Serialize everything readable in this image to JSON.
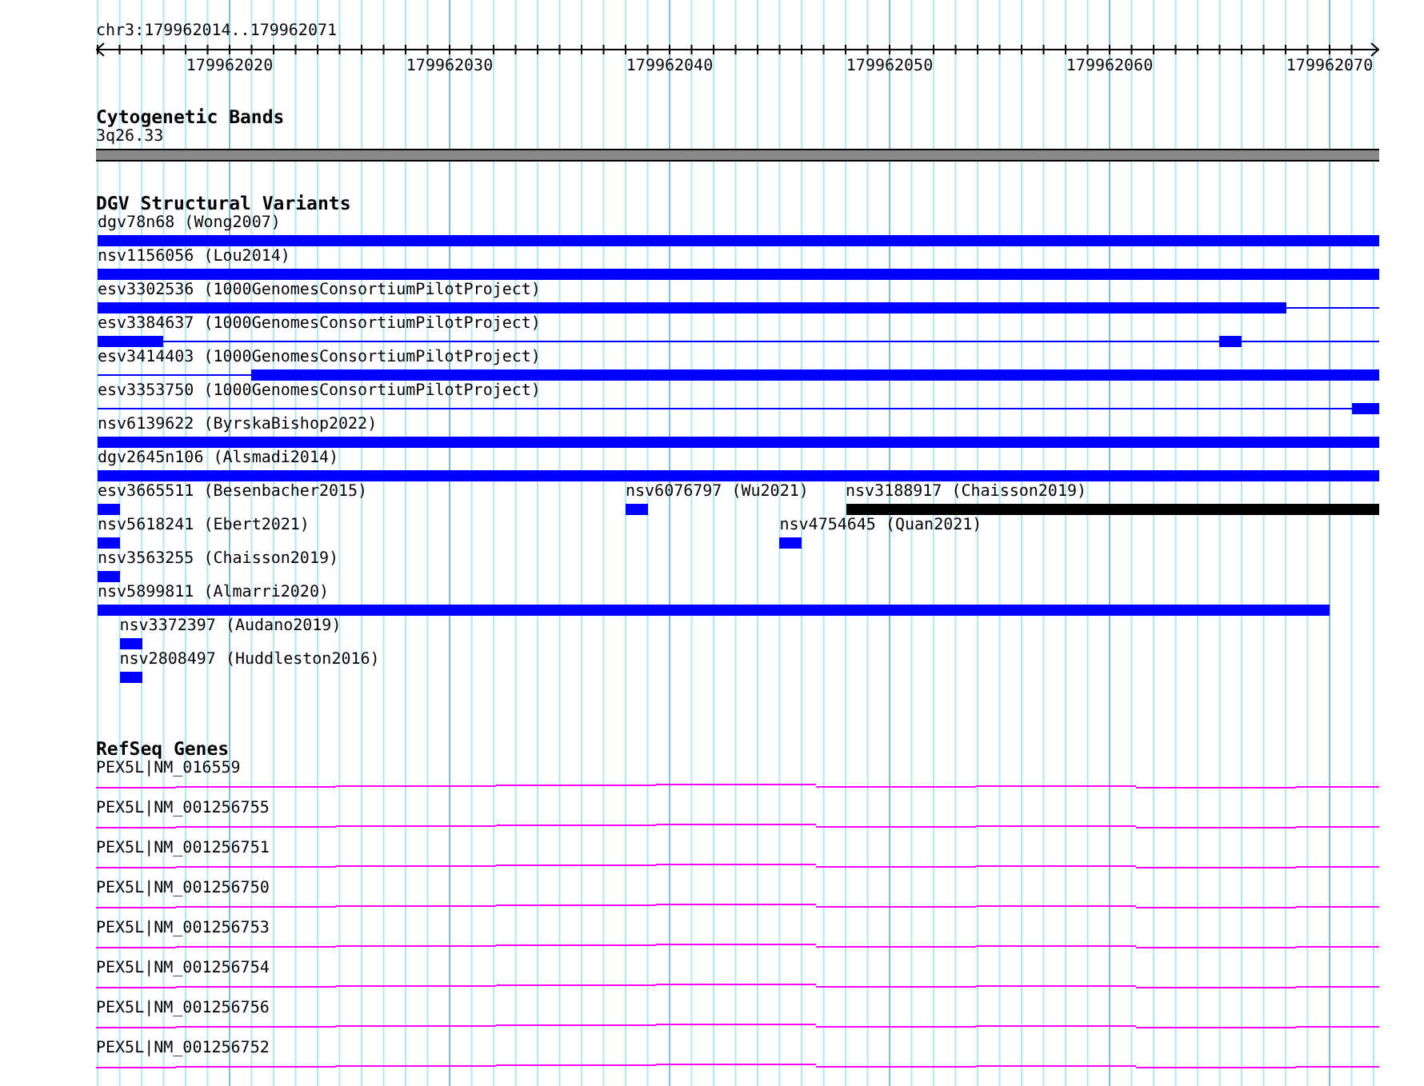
{
  "location": "chr3:179962014..179962071",
  "ruler": {
    "labels": [
      "179962020",
      "179962030",
      "179962040",
      "179962050",
      "179962060",
      "179962070"
    ]
  },
  "cytoband": {
    "title": "Cytogenetic Bands",
    "label": "3q26.33"
  },
  "dgv": {
    "title": "DGV Structural Variants",
    "rows": [
      {
        "features": [
          {
            "label": "dgv78n68 (Wong2007)",
            "color": "#0000ff"
          }
        ]
      },
      {
        "features": [
          {
            "label": "nsv1156056 (Lou2014)",
            "color": "#0000ff"
          }
        ]
      },
      {
        "features": [
          {
            "label": "esv3302536 (1000GenomesConsortiumPilotProject)",
            "color": "#0000ff"
          }
        ]
      },
      {
        "features": [
          {
            "label": "esv3384637 (1000GenomesConsortiumPilotProject)",
            "color": "#0000ff"
          }
        ]
      },
      {
        "features": [
          {
            "label": "esv3414403 (1000GenomesConsortiumPilotProject)",
            "color": "#0000ff"
          }
        ]
      },
      {
        "features": [
          {
            "label": "esv3353750 (1000GenomesConsortiumPilotProject)",
            "color": "#0000ff"
          }
        ]
      },
      {
        "features": [
          {
            "label": "nsv6139622 (ByrskaBishop2022)",
            "color": "#0000ff"
          }
        ]
      },
      {
        "features": [
          {
            "label": "dgv2645n106 (Alsmadi2014)",
            "color": "#0000ff"
          }
        ]
      },
      {
        "features": [
          {
            "label": "esv3665511 (Besenbacher2015)",
            "color": "#0000ff"
          },
          {
            "label": "nsv6076797 (Wu2021)",
            "color": "#0000ff"
          },
          {
            "label": "nsv3188917 (Chaisson2019)",
            "color": "#000000"
          }
        ]
      },
      {
        "features": [
          {
            "label": "nsv5618241 (Ebert2021)",
            "color": "#0000ff"
          },
          {
            "label": "nsv4754645 (Quan2021)",
            "color": "#0000ff"
          }
        ]
      },
      {
        "features": [
          {
            "label": "nsv3563255 (Chaisson2019)",
            "color": "#0000ff"
          }
        ]
      },
      {
        "features": [
          {
            "label": "nsv5899811 (Almarri2020)",
            "color": "#0000ff"
          }
        ]
      },
      {
        "features": [
          {
            "label": "nsv3372397 (Audano2019)",
            "color": "#0000ff"
          }
        ]
      },
      {
        "features": [
          {
            "label": "nsv2808497 (Huddleston2016)",
            "color": "#0000ff"
          }
        ]
      }
    ]
  },
  "refseq": {
    "title": "RefSeq Genes",
    "transcripts": [
      {
        "label": "PEX5L|NM_016559"
      },
      {
        "label": "PEX5L|NM_001256755"
      },
      {
        "label": "PEX5L|NM_001256751"
      },
      {
        "label": "PEX5L|NM_001256750"
      },
      {
        "label": "PEX5L|NM_001256753"
      },
      {
        "label": "PEX5L|NM_001256754"
      },
      {
        "label": "PEX5L|NM_001256756"
      },
      {
        "label": "PEX5L|NM_001256752"
      }
    ]
  }
}
